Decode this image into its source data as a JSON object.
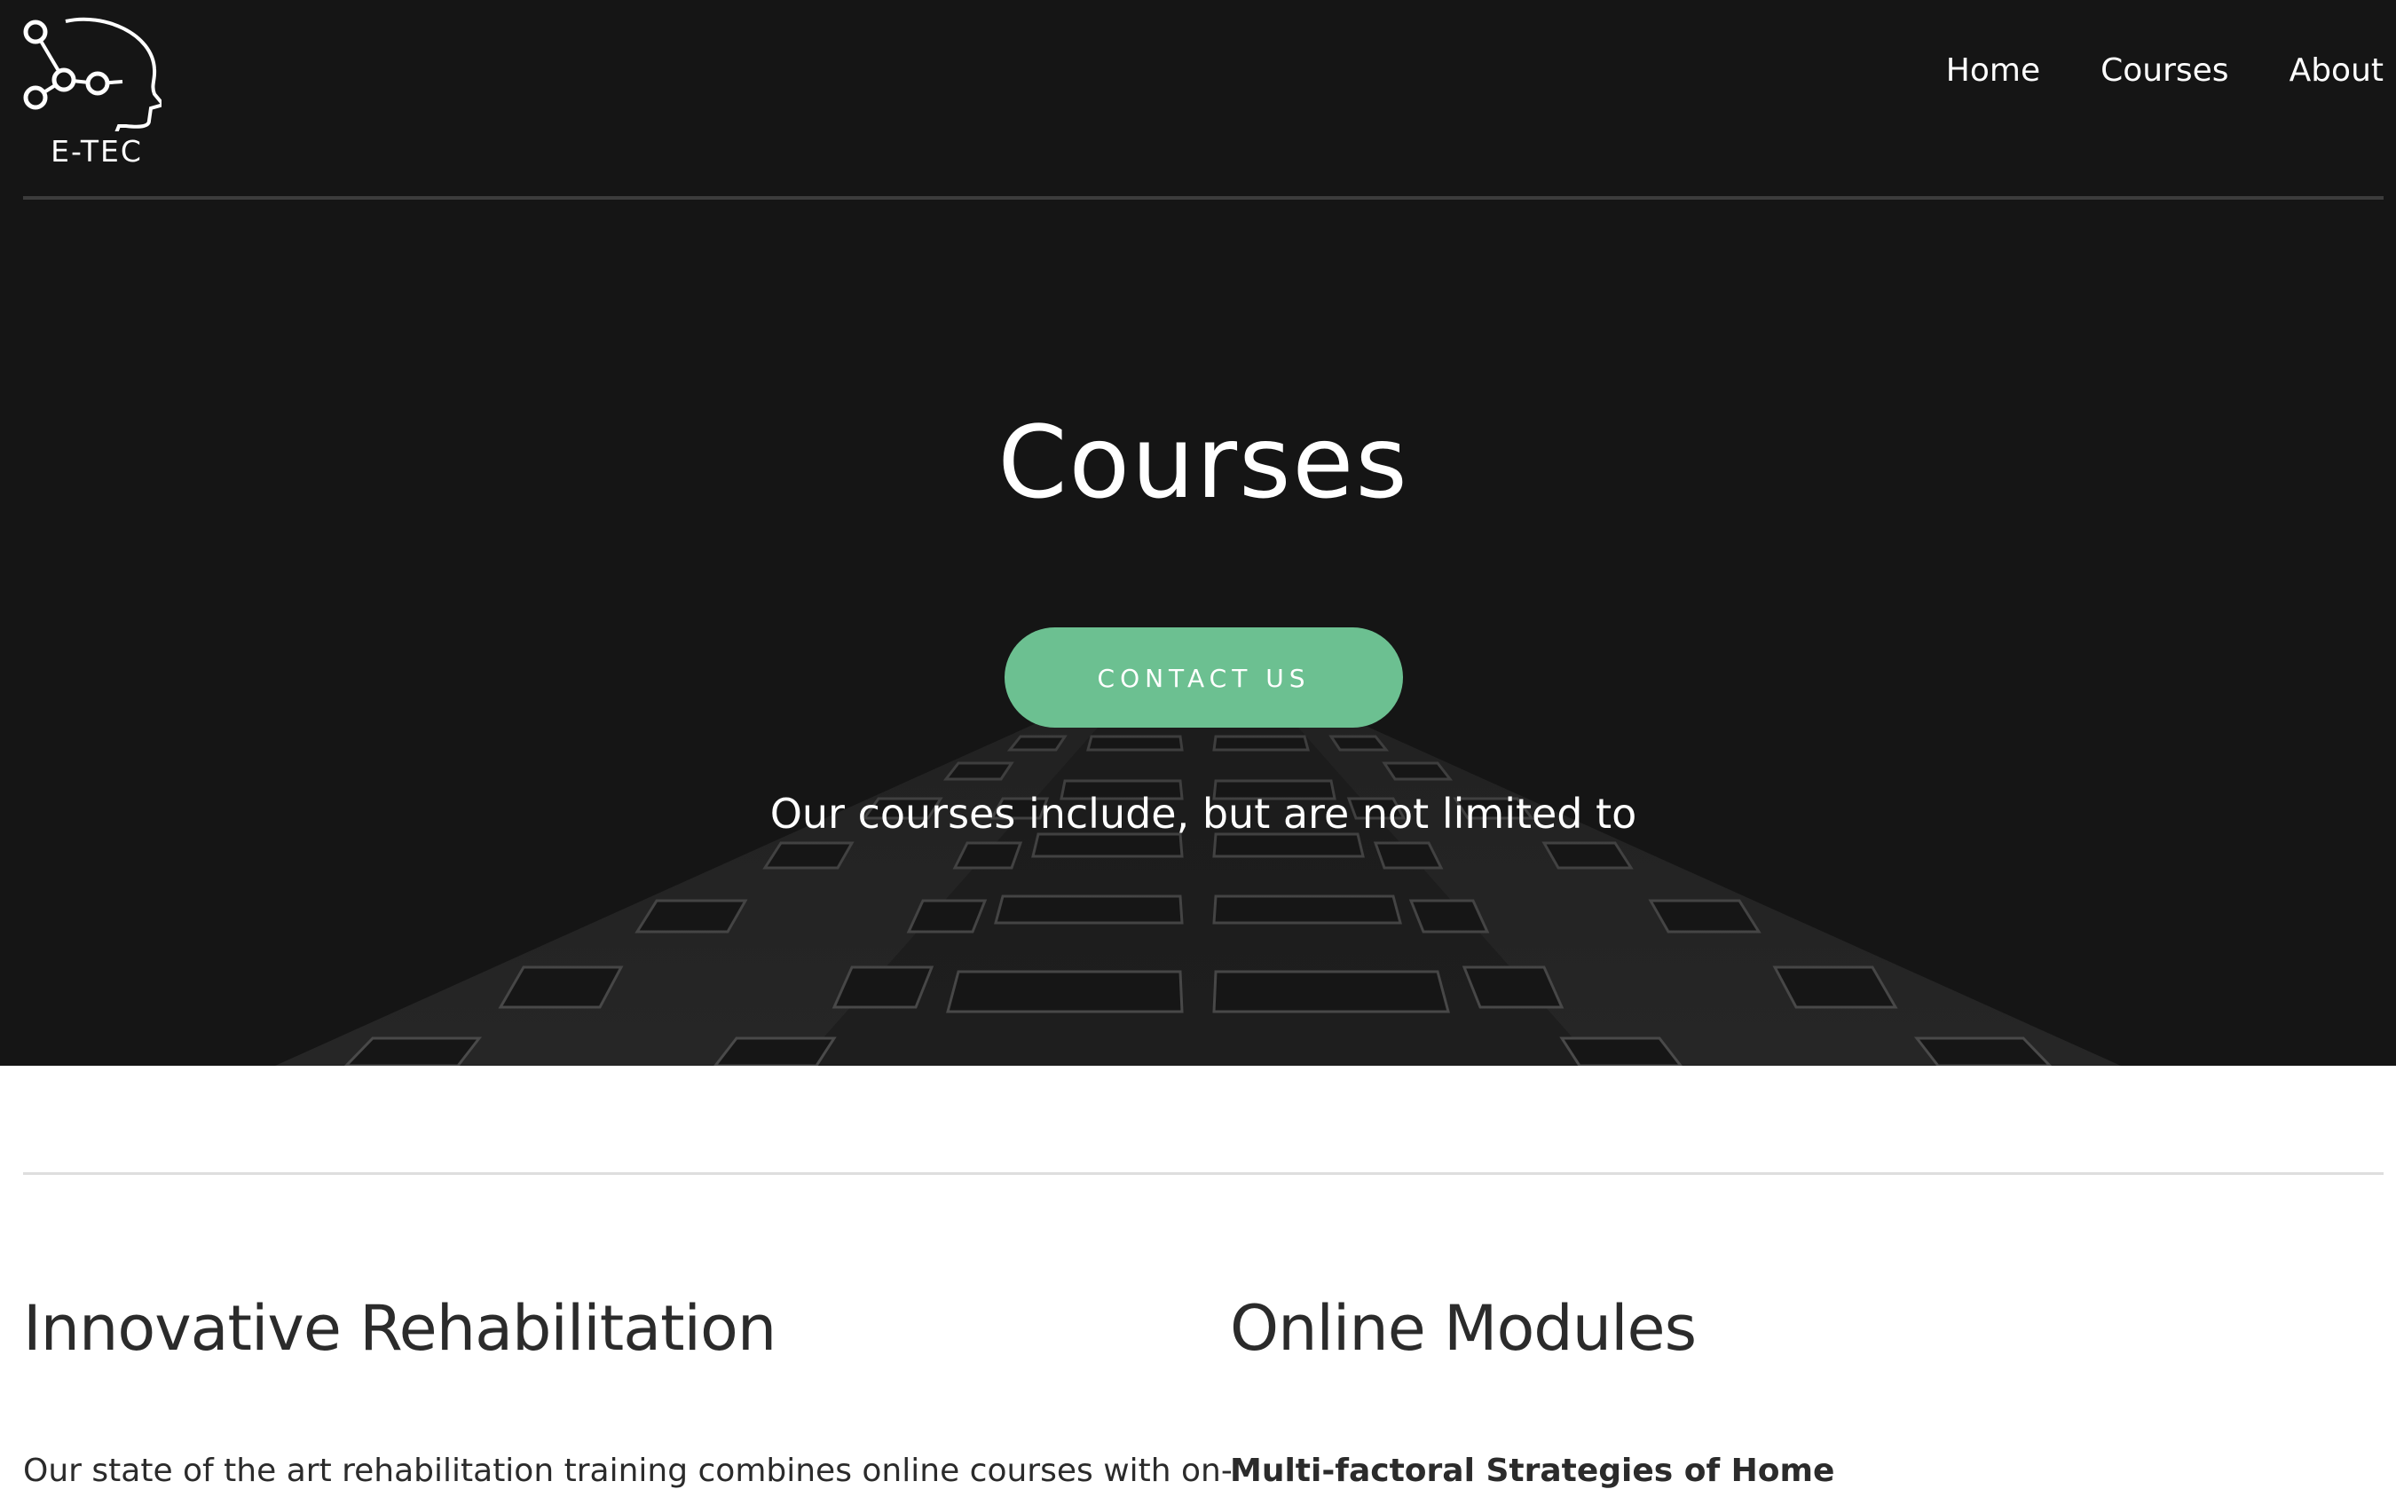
{
  "brand": {
    "logo_text": "E-TEC",
    "logo_icon": "head-network-icon"
  },
  "nav": {
    "items": [
      {
        "label": "Home"
      },
      {
        "label": "Courses"
      },
      {
        "label": "About"
      }
    ]
  },
  "hero": {
    "title": "Courses",
    "cta_label": "CONTACT US",
    "subtitle": "Our courses include, but are not limited to"
  },
  "sections": [
    {
      "heading": "Innovative Rehabilitation",
      "text": "Our state of the art rehabilitation training combines online courses with on-"
    },
    {
      "heading": "Online Modules",
      "text": "Multi-factoral Strategies of Home"
    }
  ],
  "colors": {
    "hero_background": "#151515",
    "accent": "#6cc091",
    "text_dark": "#2b2b2b",
    "page_background": "#ffffff"
  }
}
